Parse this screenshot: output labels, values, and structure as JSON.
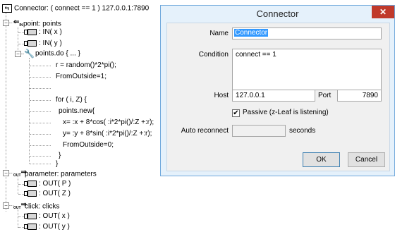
{
  "tree": {
    "root": "Connector: ( connect == 1 ) 127.0.0.1:7890",
    "point_node": "point: points",
    "point_children": [
      ": IN( x )",
      ": IN( y )"
    ],
    "do_node": "points.do { ... }",
    "code_lines": [
      "r = random()*2*pi();",
      "FromOutside=1;",
      "",
      "for ( i, Z) {",
      "points.new{",
      "x= :x + 8*cos( :i*2*pi()/:Z +:r);",
      "y= :y + 8*sin( :i*2*pi()/:Z +:r);",
      "FromOutside=0;",
      "}",
      "}"
    ],
    "param_node": "parameter: parameters",
    "param_children": [
      ": OUT( P )",
      ": OUT( Z )"
    ],
    "click_node": "click: clicks",
    "click_children": [
      ": OUT( x )",
      ": OUT( y )"
    ],
    "in_badge": "IN",
    "out_badge": "OUT"
  },
  "dialog": {
    "title": "Connector",
    "close_glyph": "✕",
    "name_label": "Name",
    "name_value": "Connector",
    "condition_label": "Condition",
    "condition_value": "connect == 1",
    "host_label": "Host",
    "host_value": "127.0.0.1",
    "port_label": "Port",
    "port_value": "7890",
    "passive_label": "Passive (z-Leaf is listening)",
    "passive_checked": "✔",
    "reconnect_label": "Auto reconnect",
    "reconnect_unit": "seconds",
    "ok_label": "OK",
    "cancel_label": "Cancel"
  }
}
